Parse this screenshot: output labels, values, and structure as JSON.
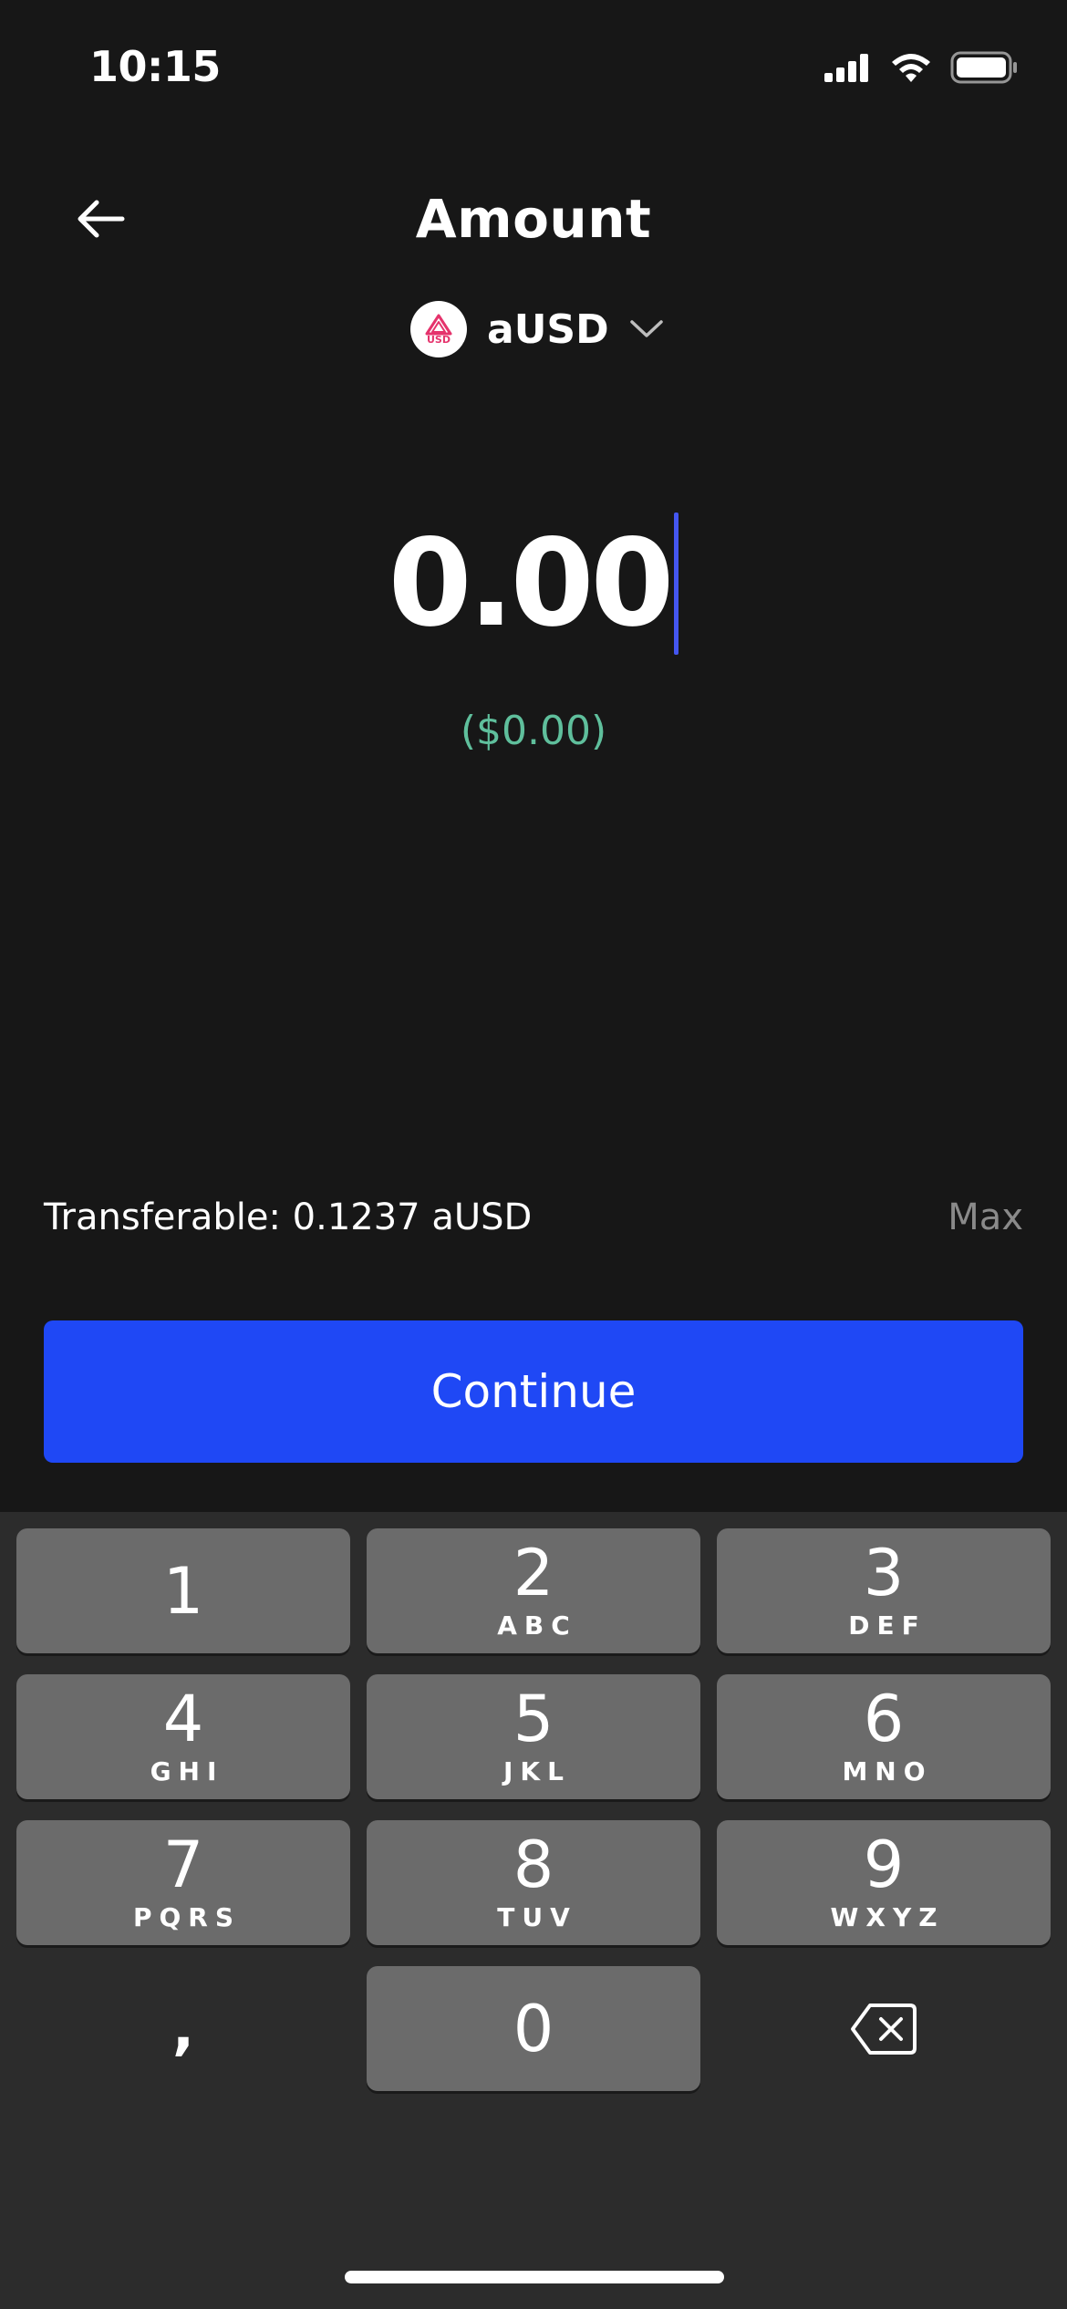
{
  "status_bar": {
    "time": "10:15",
    "signal_icon": "cellular-signal-icon",
    "wifi_icon": "wifi-icon",
    "battery_icon": "battery-icon"
  },
  "header": {
    "title": "Amount",
    "back_icon": "arrow-left-icon"
  },
  "token": {
    "symbol": "aUSD",
    "logo_text": "USD",
    "chevron_icon": "chevron-down-icon"
  },
  "amount": {
    "value": "0.00",
    "fiat": "($0.00)"
  },
  "transferable": {
    "label": "Transferable: 0.1237 aUSD",
    "max_label": "Max"
  },
  "continue_label": "Continue",
  "keyboard": {
    "keys": [
      {
        "digit": "1",
        "letters": ""
      },
      {
        "digit": "2",
        "letters": "ABC"
      },
      {
        "digit": "3",
        "letters": "DEF"
      },
      {
        "digit": "4",
        "letters": "GHI"
      },
      {
        "digit": "5",
        "letters": "JKL"
      },
      {
        "digit": "6",
        "letters": "MNO"
      },
      {
        "digit": "7",
        "letters": "PQRS"
      },
      {
        "digit": "8",
        "letters": "TUV"
      },
      {
        "digit": "9",
        "letters": "WXYZ"
      },
      {
        "digit": "0",
        "letters": ""
      }
    ],
    "separator": ",",
    "delete_icon": "backspace-icon"
  },
  "colors": {
    "background": "#171717",
    "accent": "#1f48f5",
    "fiat": "#5fbf9c",
    "caret": "#4456f0",
    "key": "#6b6b6b"
  }
}
